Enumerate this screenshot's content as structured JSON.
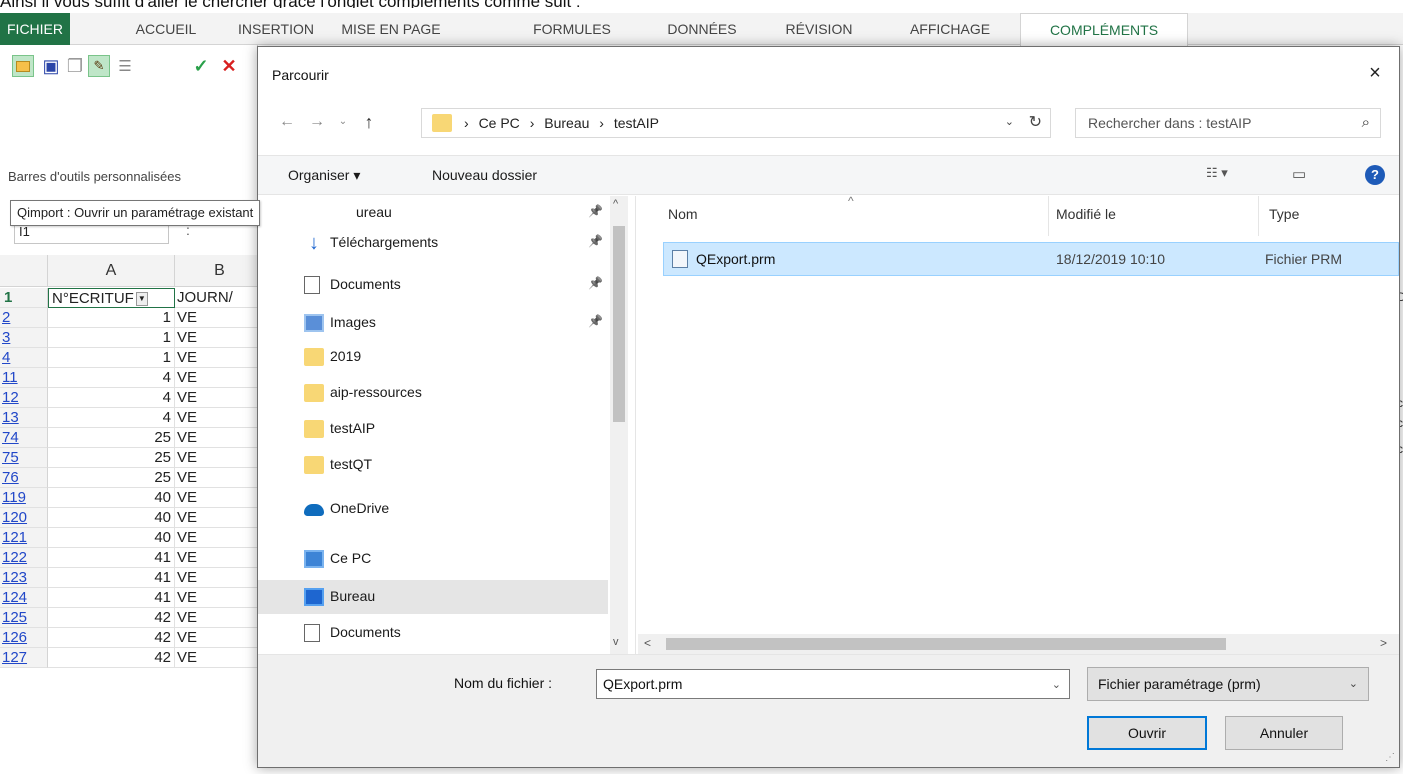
{
  "intro_text": "Ainsi il vous suffit d'aller le chercher grâce l'onglet compléments comme suit :",
  "ribbon": {
    "tabs": [
      {
        "label": "FICHIER"
      },
      {
        "label": "ACCUEIL"
      },
      {
        "label": "INSERTION"
      },
      {
        "label": "MISE EN PAGE"
      },
      {
        "label": "FORMULES"
      },
      {
        "label": "DONNÉES"
      },
      {
        "label": "RÉVISION"
      },
      {
        "label": "AFFICHAGE"
      },
      {
        "label": "COMPLÉMENTS"
      }
    ],
    "group_label": "Barres d'outils personnalisées",
    "tooltip": "Qimport : Ouvrir un paramétrage existant",
    "name_box": "I1",
    "fx_sep": ":"
  },
  "sheet": {
    "col_headers": [
      "A",
      "B"
    ],
    "header_row": {
      "num": "1",
      "a": "N°ECRITUF",
      "b": "JOURN/"
    },
    "rows": [
      {
        "num": "2",
        "a": "1",
        "b": "VE"
      },
      {
        "num": "3",
        "a": "1",
        "b": "VE"
      },
      {
        "num": "4",
        "a": "1",
        "b": "VE"
      },
      {
        "num": "11",
        "a": "4",
        "b": "VE"
      },
      {
        "num": "12",
        "a": "4",
        "b": "VE"
      },
      {
        "num": "13",
        "a": "4",
        "b": "VE"
      },
      {
        "num": "74",
        "a": "25",
        "b": "VE"
      },
      {
        "num": "75",
        "a": "25",
        "b": "VE"
      },
      {
        "num": "76",
        "a": "25",
        "b": "VE"
      },
      {
        "num": "119",
        "a": "40",
        "b": "VE"
      },
      {
        "num": "120",
        "a": "40",
        "b": "VE"
      },
      {
        "num": "121",
        "a": "40",
        "b": "VE"
      },
      {
        "num": "122",
        "a": "41",
        "b": "VE"
      },
      {
        "num": "123",
        "a": "41",
        "b": "VE"
      },
      {
        "num": "124",
        "a": "41",
        "b": "VE"
      },
      {
        "num": "125",
        "a": "42",
        "b": "VE"
      },
      {
        "num": "126",
        "a": "42",
        "b": "VE"
      },
      {
        "num": "127",
        "a": "42",
        "b": "VE"
      }
    ]
  },
  "dialog": {
    "title": "Parcourir",
    "close": "×",
    "path": [
      "Ce PC",
      "Bureau",
      "testAIP"
    ],
    "path_sep": "›",
    "search_placeholder": "Rechercher dans : testAIP",
    "organize": "Organiser ▾",
    "new_folder": "Nouveau dossier",
    "nav_items": [
      {
        "label": "ureau",
        "icon": "desktop-icon",
        "pinned": true
      },
      {
        "label": "Téléchargements",
        "icon": "download-icon",
        "pinned": true
      },
      {
        "label": "Documents",
        "icon": "documents-icon",
        "pinned": true
      },
      {
        "label": "Images",
        "icon": "images-icon",
        "pinned": true
      },
      {
        "label": "2019",
        "icon": "folder-icon",
        "pinned": false
      },
      {
        "label": "aip-ressources",
        "icon": "folder-icon",
        "pinned": false
      },
      {
        "label": "testAIP",
        "icon": "folder-icon",
        "pinned": false
      },
      {
        "label": "testQT",
        "icon": "folder-icon",
        "pinned": false
      },
      {
        "label": "OneDrive",
        "icon": "cloud-icon",
        "pinned": false
      },
      {
        "label": "Ce PC",
        "icon": "computer-icon",
        "pinned": false
      },
      {
        "label": "Bureau",
        "icon": "desktop-icon",
        "pinned": false,
        "selected": true
      },
      {
        "label": "Documents",
        "icon": "documents-icon",
        "pinned": false
      }
    ],
    "columns": {
      "name": "Nom",
      "modified": "Modifié le",
      "type": "Type"
    },
    "files": [
      {
        "name": "QExport.prm",
        "modified": "18/12/2019 10:10",
        "type": "Fichier PRM"
      }
    ],
    "filename_label": "Nom du fichier :",
    "filename_value": "QExport.prm",
    "filter_value": "Fichier paramétrage (prm)",
    "open_label": "Ouvrir",
    "cancel_label": "Annuler"
  },
  "colors": {
    "excel_green": "#217346",
    "selection": "#cce8ff",
    "accent": "#0078d7"
  }
}
